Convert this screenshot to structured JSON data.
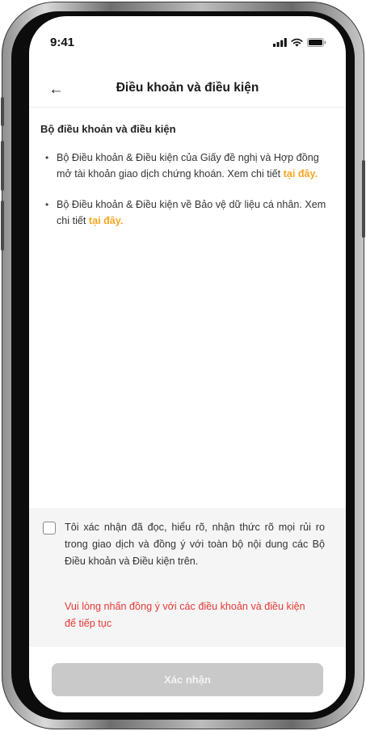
{
  "status_bar": {
    "time": "9:41"
  },
  "header": {
    "title": "Điều khoản và điều kiện"
  },
  "content": {
    "section_title": "Bộ điều khoản và điều kiện",
    "items": [
      {
        "bullet": "•",
        "text": "Bộ Điều khoản & Điều kiện của Giấy đề nghị và Hợp đồng mở tài khoản giao dịch chứng khoán. Xem chi tiết ",
        "link": "tại đây."
      },
      {
        "bullet": "•",
        "text": "Bộ Điều khoản & Điều kiện về Bảo vệ dữ liệu cá nhân. Xem chi tiết ",
        "link": "tại đây."
      }
    ]
  },
  "consent": {
    "checkbox_label": "Tôi xác nhận đã đọc, hiểu rõ, nhận thức rõ mọi rủi ro trong giao dịch và đồng ý với toàn bộ nội dung các Bộ Điều khoản và Điều kiện trên.",
    "error": "Vui lòng nhấn đồng ý với các điều khoản và điều kiện để tiếp tục"
  },
  "footer": {
    "confirm_label": "Xác nhận"
  },
  "colors": {
    "accent": "#f5a623",
    "error": "#e53935",
    "disabled_button": "#c9c9c9"
  },
  "icons": {
    "back": "arrow-left-icon",
    "signal": "signal-icon",
    "wifi": "wifi-icon",
    "battery": "battery-icon"
  }
}
